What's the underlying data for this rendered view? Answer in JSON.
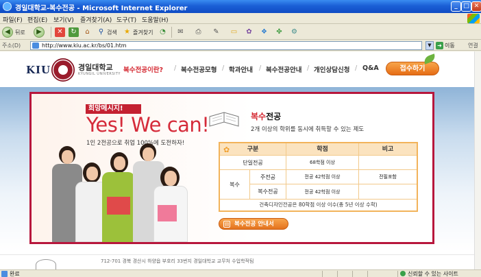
{
  "window": {
    "title": "경일대학교-복수전공 - Microsoft Internet Explorer",
    "minimize": "_",
    "maximize": "□",
    "close": "✕"
  },
  "menu": [
    "파일(F)",
    "편집(E)",
    "보기(V)",
    "즐겨찾기(A)",
    "도구(T)",
    "도움말(H)"
  ],
  "toolbar": {
    "back": "뒤로",
    "search": "검색",
    "favorites": "즐겨찾기"
  },
  "address": {
    "label": "주소(D)",
    "url": "http://www.kiu.ac.kr/bs/01.htm",
    "go": "이동",
    "links": "연결"
  },
  "site": {
    "logo_text": "KIU",
    "univ_name": "경일대학교",
    "univ_sub": "KYUNGIL UNIVERSITY",
    "nav": [
      "복수전공이란?",
      "복수전공모형",
      "학과안내",
      "복수전공안내",
      "개인상담신청",
      "Q&A"
    ],
    "apply": "접수하기"
  },
  "hero": {
    "hope": "희망메시지!",
    "headline": "Yes! We can!",
    "slogan": "1인 2전공으로 취업 100%에 도전하자!",
    "title_red": "복수",
    "title_rest": "전공",
    "description": "2개 이상의 학위를 동시에 취득할 수 있는 제도"
  },
  "table": {
    "headers": [
      "구분",
      "학점",
      "비고"
    ],
    "single_label": "단일전공",
    "single_credit": "68학점 이상",
    "double_label": "복수",
    "main_label": "주전공",
    "main_credit": "전공 42학점 이상",
    "main_note": "전필포함",
    "second_label": "복수전공",
    "second_credit": "전공 42학점 이상",
    "note": "건축디자인전공은 80학점 이상 이수(총 5년 이상 수학)"
  },
  "guide_button": "복수전공 안내서",
  "footer": {
    "address": "712-701 경북 경산시 하양읍 부호리 33번지 경일대학교 교무처 수업학적팀"
  },
  "status": {
    "text": "완료",
    "zone": "신뢰할 수 있는 사이트"
  }
}
